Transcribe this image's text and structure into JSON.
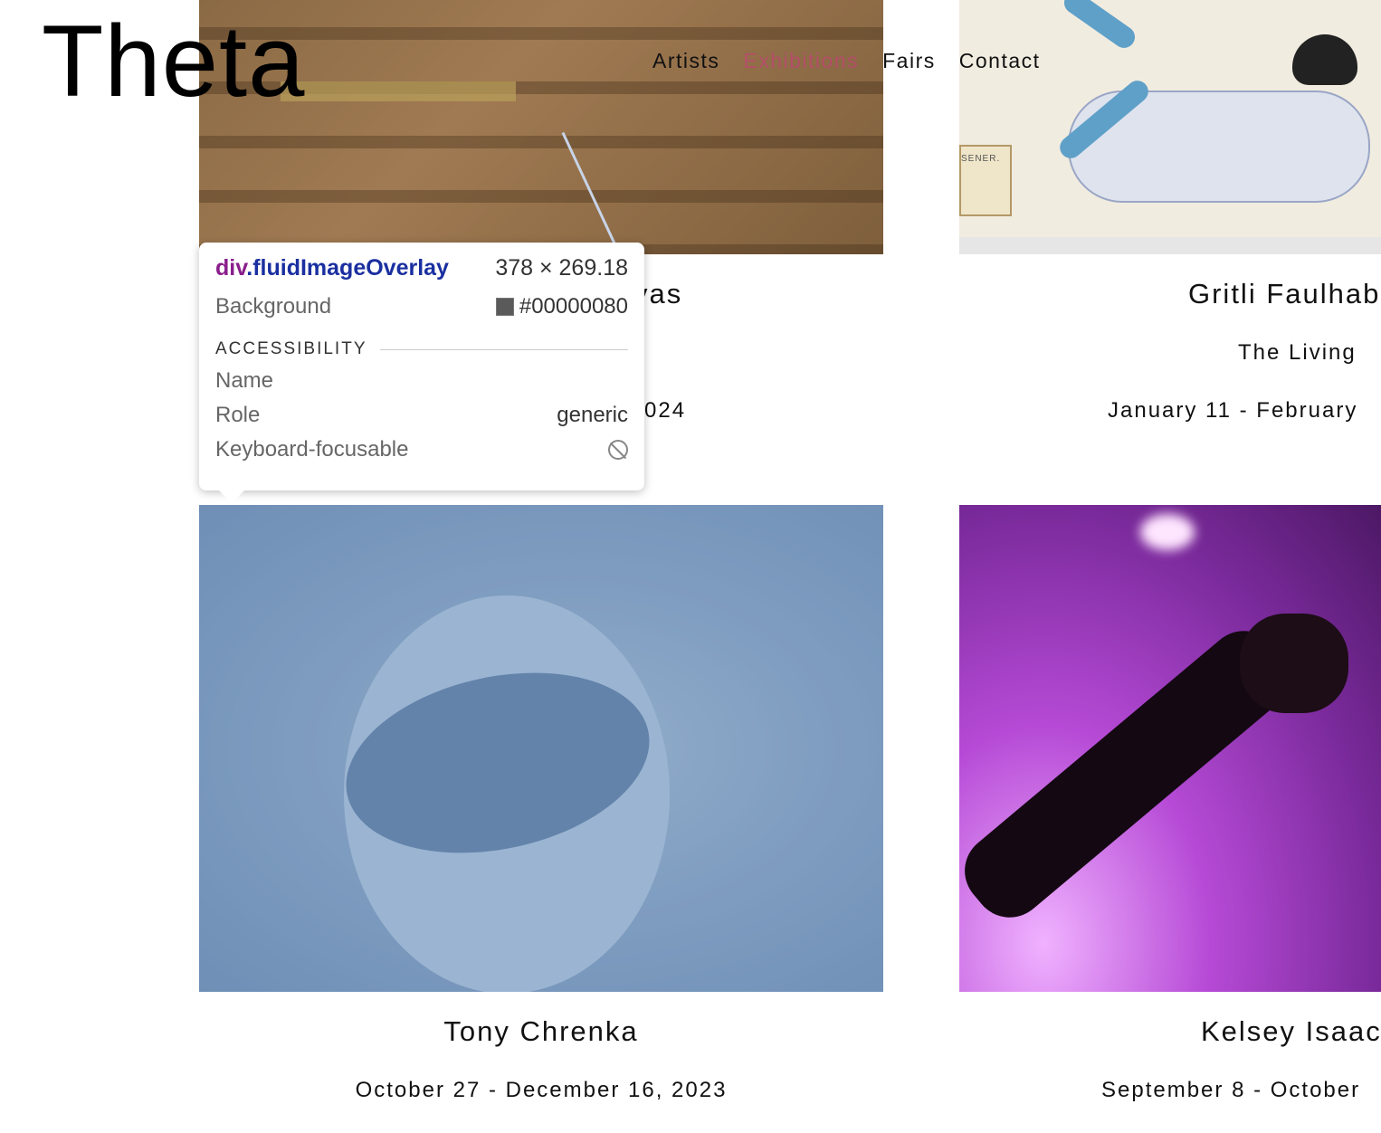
{
  "header": {
    "logo": "Theta",
    "nav": [
      {
        "label": "Artists"
      },
      {
        "label": "Exhibitions",
        "active": true
      },
      {
        "label": "Fairs"
      },
      {
        "label": "Contact"
      }
    ],
    "active_color": "#c83e7a"
  },
  "exhibitions": [
    {
      "name_fragment": "vas",
      "date_fragment": "024"
    },
    {
      "artist": "Gritli Faulhab",
      "title": "The Living",
      "dates": "January 11 - February"
    },
    {
      "artist": "Tony Chrenka",
      "dates": "October 27 - December 16, 2023"
    },
    {
      "artist": "Kelsey Isaac",
      "dates": "September 8 - October"
    }
  ],
  "inspector": {
    "tag": "div",
    "class": ".fluidImageOverlay",
    "size": "378 × 269.18",
    "background_label": "Background",
    "background_value": "#00000080",
    "section": "ACCESSIBILITY",
    "name_label": "Name",
    "name_value": "",
    "role_label": "Role",
    "role_value": "generic",
    "focus_label": "Keyboard-focusable",
    "focus_icon": "no-entry-icon",
    "swatch_color": "#5a5a5a"
  },
  "image_box_text": "SENER."
}
